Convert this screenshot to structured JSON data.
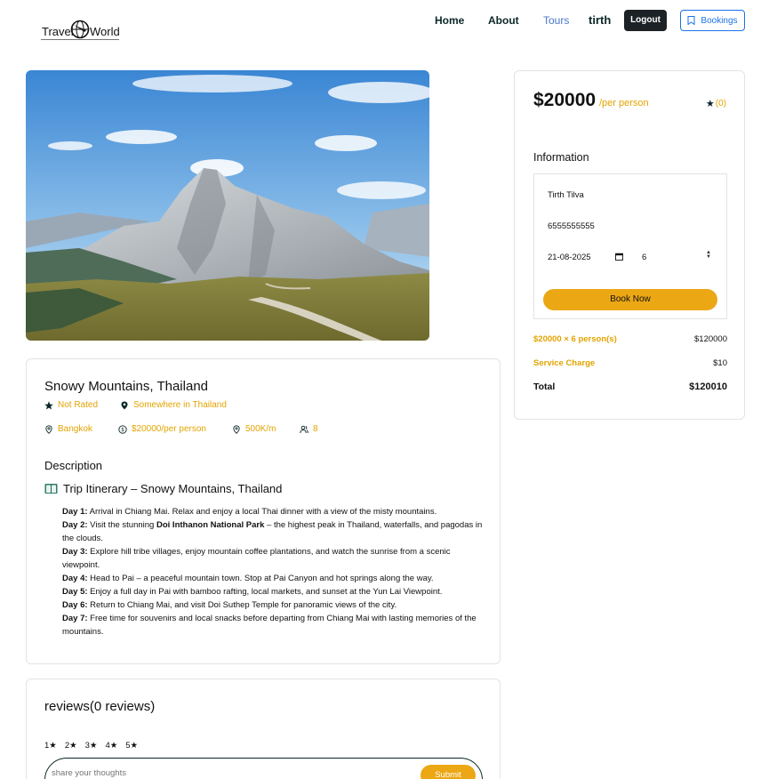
{
  "header": {
    "logo_left": "Travel",
    "logo_right": "World",
    "nav": {
      "home": "Home",
      "about": "About",
      "tours": "Tours"
    },
    "username": "tirth",
    "logout_label": "Logout",
    "bookings_label": "Bookings"
  },
  "tour": {
    "title": "Snowy Mountains, Thailand",
    "rating": "Not Rated",
    "address": "Somewhere in Thailand",
    "city": "Bangkok",
    "price_per_person": "$20000/per person",
    "distance": "500K/m",
    "max_group": "8",
    "description_heading": "Description",
    "itinerary_heading": "Trip Itinerary – Snowy Mountains, Thailand",
    "itinerary": [
      {
        "day": "Day 1:",
        "pre": "Arrival in Chiang Mai. Relax and enjoy a local Thai dinner with a view of the misty mountains.",
        "bold": "",
        "post": ""
      },
      {
        "day": "Day 2:",
        "pre": "Visit the stunning ",
        "bold": "Doi Inthanon National Park",
        "post": " – the highest peak in Thailand, waterfalls, and pagodas in the clouds."
      },
      {
        "day": "Day 3:",
        "pre": "Explore hill tribe villages, enjoy mountain coffee plantations, and watch the sunrise from a scenic viewpoint.",
        "bold": "",
        "post": ""
      },
      {
        "day": "Day 4:",
        "pre": "Head to Pai – a peaceful mountain town. Stop at Pai Canyon and hot springs along the way.",
        "bold": "",
        "post": ""
      },
      {
        "day": "Day 5:",
        "pre": "Enjoy a full day in Pai with bamboo rafting, local markets, and sunset at the Yun Lai Viewpoint.",
        "bold": "",
        "post": ""
      },
      {
        "day": "Day 6:",
        "pre": "Return to Chiang Mai, and visit Doi Suthep Temple for panoramic views of the city.",
        "bold": "",
        "post": ""
      },
      {
        "day": "Day 7:",
        "pre": "Free time for souvenirs and local snacks before departing from Chiang Mai with lasting memories of the mountains.",
        "bold": "",
        "post": ""
      }
    ]
  },
  "reviews": {
    "heading": "reviews(0 reviews)",
    "star_options": [
      "1★",
      "2★",
      "3★",
      "4★",
      "5★"
    ],
    "placeholder": "share your thoughts",
    "submit_label": "Submit"
  },
  "booking": {
    "price": "$20000",
    "per_person": "/per person",
    "rating_count": "(0)",
    "info_heading": "Information",
    "full_name": "Tirth Tilva",
    "phone": "6555555555",
    "date": "21-08-2025",
    "guests": "6",
    "book_now_label": "Book Now",
    "price_line_label": "$20000 × 6 person(s)",
    "price_line_value": "$120000",
    "service_label": "Service Charge",
    "service_value": "$10",
    "total_label": "Total",
    "total_value": "$120010"
  },
  "colors": {
    "accent": "#eba714",
    "heading": "#0b2727",
    "link": "#1a73e8",
    "active_nav": "#4a76c9"
  }
}
